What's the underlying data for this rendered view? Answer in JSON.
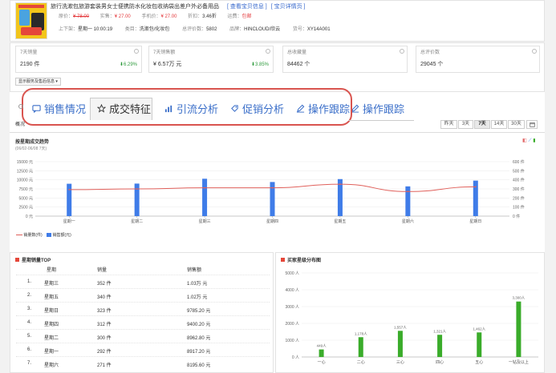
{
  "product": {
    "title": "旅行洗漱包旅游套装男女士便携防水化妆包收纳袋出差户外必备用品",
    "link_view": "[ 查看宝贝信息 ]",
    "link_detail": "[ 宝贝详情页 ]",
    "price_label": "原价：",
    "price_orig": "¥ 78.00",
    "paid_label": "实售：",
    "paid": "¥ 27.00",
    "mobile_label": "手机价：",
    "mobile": "¥ 27.00",
    "discount_label": "折扣：",
    "discount": "3.46折",
    "shipping_label": "运费：",
    "shipping": "包邮",
    "listed_label": "上下架：",
    "listed": "星期一 10:00:19",
    "category_label": "类目：",
    "category": "洗漱包/化妆包",
    "reviews_label": "总评价数：",
    "reviews": "5802",
    "brand_label": "品牌：",
    "brand": "HINCLOUD/欣云",
    "sku_label": "货号：",
    "sku": "XY14A001"
  },
  "cards": [
    {
      "title": "7天销量",
      "value": "2190 件",
      "change": "6.29%"
    },
    {
      "title": "7天销售额",
      "value": "¥ 6.57万 元",
      "change": "3.85%"
    },
    {
      "title": "总收藏量",
      "value": "84462 个",
      "change": ""
    },
    {
      "title": "总评价数",
      "value": "29045 个",
      "change": ""
    }
  ],
  "service_button": "显示服务及售后信息 ▾",
  "tabs": [
    "销售情况",
    "成交特征",
    "引流分析",
    "促销分析",
    "操作跟踪",
    "操作跟踪"
  ],
  "overview_label": "概况",
  "ranges": [
    "昨天",
    "3天",
    "7天",
    "14天",
    "30天"
  ],
  "trend": {
    "title": "按星期成交趋势",
    "subtitle": "(06/02-06/08 7天)",
    "legend_volume": "销量数(件)",
    "legend_amount": "销售额(元)"
  },
  "chart_data": [
    {
      "type": "bar",
      "title": "按星期成交趋势",
      "categories": [
        "星期一",
        "星期二",
        "星期三",
        "星期四",
        "星期五",
        "星期六",
        "星期日"
      ],
      "series": [
        {
          "name": "销售额(元)",
          "type": "bar",
          "axis": "left",
          "values": [
            8917,
            8962,
            10300,
            9400,
            10200,
            8195,
            9785
          ]
        },
        {
          "name": "销量数(件)",
          "type": "line",
          "axis": "right",
          "values": [
            292,
            300,
            312,
            312,
            352,
            271,
            323
          ]
        }
      ],
      "left_axis": {
        "ticks": [
          "15000 元",
          "12500 元",
          "10000 元",
          "7500 元",
          "5000 元",
          "2500 元",
          "0 元"
        ],
        "ylim": [
          0,
          15000
        ]
      },
      "right_axis": {
        "ticks": [
          "600 件",
          "500 件",
          "400 件",
          "300 件",
          "200 件",
          "100 件",
          "0 件"
        ],
        "ylim": [
          0,
          600
        ]
      }
    },
    {
      "type": "bar",
      "title": "买家星级分布图",
      "categories": [
        "一心",
        "二心",
        "三心",
        "四心",
        "五心",
        "一钻及以上"
      ],
      "values": [
        449,
        1178,
        1557,
        1321,
        1462,
        3300
      ],
      "value_labels": [
        "449人",
        "1,178人",
        "1,557人",
        "1,321人",
        "1,462人",
        "3,300人"
      ],
      "y_ticks": [
        "5000 人",
        "4000 人",
        "3000 人",
        "2000 人",
        "1000 人",
        "0 人"
      ],
      "ylim": [
        0,
        5000
      ]
    }
  ],
  "top_table": {
    "title": "星期销量TOP",
    "headers": [
      "",
      "星期",
      "销量",
      "销售额"
    ],
    "rows": [
      [
        "1.",
        "星期三",
        "352 件",
        "1.03万 元"
      ],
      [
        "2.",
        "星期五",
        "340 件",
        "1.02万 元"
      ],
      [
        "3.",
        "星期日",
        "323 件",
        "9785.20 元"
      ],
      [
        "4.",
        "星期四",
        "312 件",
        "9400.20 元"
      ],
      [
        "5.",
        "星期二",
        "300 件",
        "8962.80 元"
      ],
      [
        "6.",
        "星期一",
        "292 件",
        "8917.20 元"
      ],
      [
        "7.",
        "星期六",
        "271 件",
        "8195.60 元"
      ]
    ]
  },
  "star_title": "买家星级分布图",
  "colors": {
    "bar_blue": "#3f7ce8",
    "line_red": "#e0605b",
    "bar_green": "#3aac2a",
    "tab_blue": "#3b6fc9",
    "highlight": "#d9544f"
  }
}
